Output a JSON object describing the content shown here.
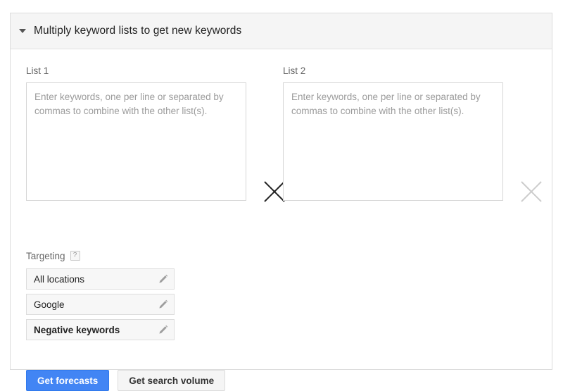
{
  "panel": {
    "title": "Multiply keyword lists to get new keywords",
    "caret_icon": "triangle-down-icon",
    "expanded": true
  },
  "lists": [
    {
      "label": "List 1",
      "placeholder": "Enter keywords, one per line or separated by commas to combine with the other list(s).",
      "value": ""
    },
    {
      "label": "List 2",
      "placeholder": "Enter keywords, one per line or separated by commas to combine with the other list(s).",
      "value": ""
    }
  ],
  "multiply_icons": [
    {
      "name": "multiply-x-icon",
      "state": "active",
      "color": "#212121"
    },
    {
      "name": "multiply-x-icon",
      "state": "inactive",
      "color": "#cccccc"
    }
  ],
  "targeting": {
    "label": "Targeting",
    "help_icon": "question-mark-icon",
    "help_glyph": "?",
    "rows": [
      {
        "label": "All locations",
        "bold": false,
        "edit_icon": "pencil-icon"
      },
      {
        "label": "Google",
        "bold": false,
        "edit_icon": "pencil-icon"
      },
      {
        "label": "Negative keywords",
        "bold": true,
        "edit_icon": "pencil-icon"
      }
    ]
  },
  "actions": {
    "primary_label": "Get forecasts",
    "secondary_label": "Get search volume"
  },
  "colors": {
    "primary_blue": "#4285f4",
    "primary_blue_border": "#3079ed",
    "panel_border": "#dcdcdc",
    "header_bg": "#f5f5f5",
    "row_bg": "#f7f7f7",
    "placeholder_text": "#9b9b9b",
    "label_text": "#666666"
  }
}
